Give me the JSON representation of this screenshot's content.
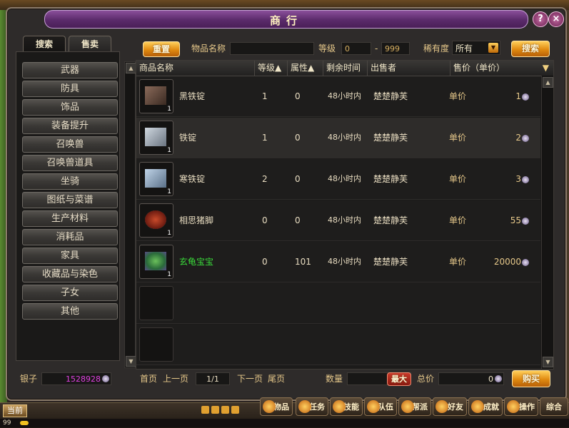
{
  "window": {
    "title": "商行"
  },
  "tabs": [
    {
      "label": "搜索"
    },
    {
      "label": "售卖"
    }
  ],
  "categories": [
    "武器",
    "防具",
    "饰品",
    "装备提升",
    "召唤兽",
    "召唤兽道具",
    "坐骑",
    "图纸与菜谱",
    "生产材料",
    "消耗品",
    "家具",
    "收藏品与染色",
    "子女",
    "其他"
  ],
  "search": {
    "reset_label": "重置",
    "item_name_label": "物品名称",
    "item_name_value": "",
    "level_label": "等级",
    "level_min": "0",
    "level_sep": "-",
    "level_max": "999",
    "rarity_label": "稀有度",
    "rarity_value": "所有",
    "search_label": "搜索"
  },
  "table": {
    "headers": [
      "商品名称",
      "等级▲",
      "属性▲",
      "剩余时间",
      "出售者",
      "售价（单价）"
    ],
    "rows": [
      {
        "name": "黑铁锭",
        "qty": "1",
        "level": "1",
        "attr": "0",
        "time": "48小时内",
        "seller": "楚楚静芙",
        "unit": "单价",
        "price": "1",
        "icon": "black-iron-ingot-icon",
        "color": "#e8dcc0"
      },
      {
        "name": "铁锭",
        "qty": "1",
        "level": "1",
        "attr": "0",
        "time": "48小时内",
        "seller": "楚楚静芙",
        "unit": "单价",
        "price": "2",
        "icon": "iron-ingot-icon",
        "color": "#e8dcc0"
      },
      {
        "name": "寒铁锭",
        "qty": "1",
        "level": "2",
        "attr": "0",
        "time": "48小时内",
        "seller": "楚楚静芙",
        "unit": "单价",
        "price": "3",
        "icon": "cold-iron-ingot-icon",
        "color": "#e8dcc0"
      },
      {
        "name": "相思猪脚",
        "qty": "1",
        "level": "0",
        "attr": "0",
        "time": "48小时内",
        "seller": "楚楚静芙",
        "unit": "单价",
        "price": "55",
        "icon": "pig-trotter-icon",
        "color": "#e8dcc0"
      },
      {
        "name": "玄龟宝宝",
        "qty": "1",
        "level": "0",
        "attr": "101",
        "time": "48小时内",
        "seller": "楚楚静芙",
        "unit": "单价",
        "price": "20000",
        "icon": "turtle-pet-icon",
        "color": "#3adc3a"
      }
    ]
  },
  "footer": {
    "silver_label": "银子",
    "silver_value": "1528928",
    "first_page": "首页",
    "prev_page": "上一页",
    "page_indicator": "1/1",
    "next_page": "下一页",
    "last_page": "尾页",
    "quantity_label": "数量",
    "max_label": "最大",
    "total_label": "总价",
    "total_value": "0",
    "buy_label": "购买"
  },
  "gamebar": {
    "channel": "当前",
    "level": "99",
    "buttons": [
      "物品",
      "任务",
      "技能",
      "队伍",
      "帮派",
      "好友",
      "成就",
      "操作",
      "综合"
    ]
  },
  "colors": {
    "accent": "#e08a10",
    "title_bar": "#5a2a6a",
    "pet_name": "#3adc3a"
  }
}
